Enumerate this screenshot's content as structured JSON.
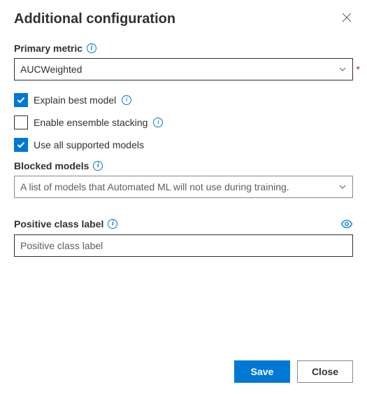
{
  "title": "Additional configuration",
  "primary_metric": {
    "label": "Primary metric",
    "value": "AUCWeighted"
  },
  "checkboxes": {
    "explain_best_model": {
      "label": "Explain best model",
      "checked": true
    },
    "enable_ensemble_stacking": {
      "label": "Enable ensemble stacking",
      "checked": false
    },
    "use_all_supported_models": {
      "label": "Use all supported models",
      "checked": true
    }
  },
  "blocked_models": {
    "label": "Blocked models",
    "placeholder": "A list of models that Automated ML will not use during training."
  },
  "positive_class": {
    "label": "Positive class label",
    "placeholder": "Positive class label"
  },
  "buttons": {
    "save": "Save",
    "close": "Close"
  }
}
